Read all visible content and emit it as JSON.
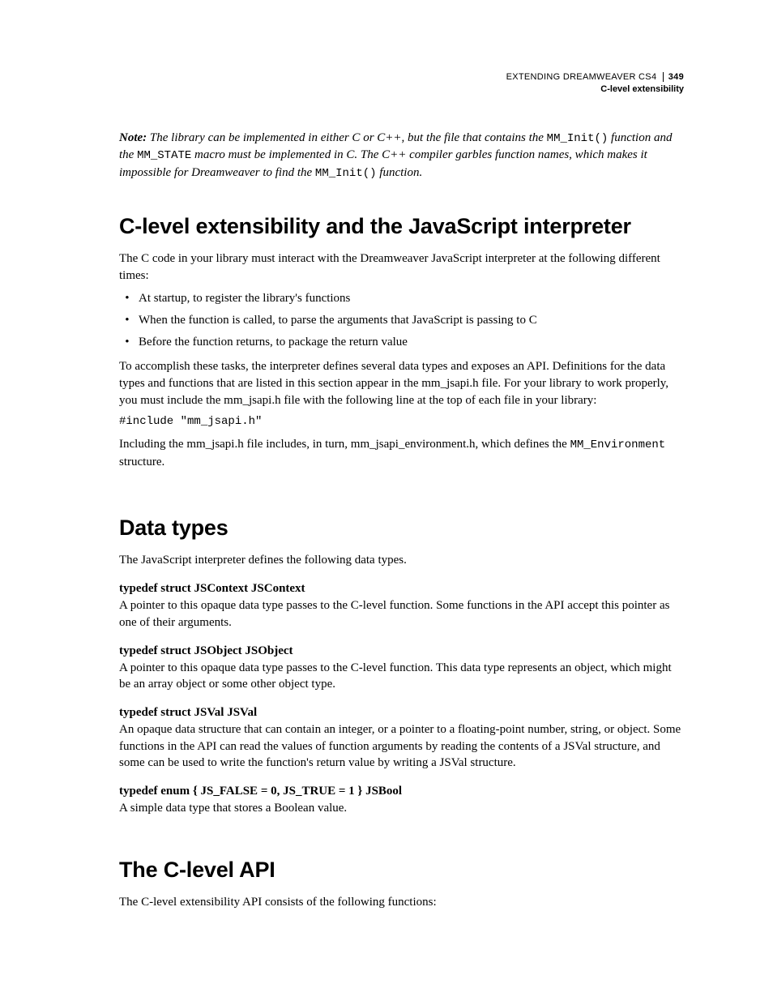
{
  "header": {
    "doc_title": "EXTENDING DREAMWEAVER CS4",
    "page_number": "349",
    "section": "C-level extensibility"
  },
  "note": {
    "label": "Note:",
    "text_a": " The library can be implemented in either C or C++, but the file that contains the ",
    "code_a": "MM_Init()",
    "text_b": " function and the ",
    "code_b": "MM_STATE",
    "text_c": " macro must be implemented in C. The C++ compiler garbles function names, which makes it impossible for Dreamweaver to find the ",
    "code_c": "MM_Init()",
    "text_d": " function."
  },
  "section1": {
    "heading": "C-level extensibility and the JavaScript interpreter",
    "intro": "The C code in your library must interact with the Dreamweaver JavaScript interpreter at the following different times:",
    "bullets": [
      "At startup, to register the library's functions",
      "When the function is called, to parse the arguments that JavaScript is passing to C",
      "Before the function returns, to package the return value"
    ],
    "para2": "To accomplish these tasks, the interpreter defines several data types and exposes an API. Definitions for the data types and functions that are listed in this section appear in the mm_jsapi.h file. For your library to work properly, you must include the mm_jsapi.h file with the following line at the top of each file in your library:",
    "code": "#include \"mm_jsapi.h\"",
    "para3_a": "Including the mm_jsapi.h file includes, in turn, mm_jsapi_environment.h, which defines the ",
    "para3_code": "MM_Environment",
    "para3_b": " structure."
  },
  "section2": {
    "heading": "Data types",
    "intro": "The JavaScript interpreter defines the following data types.",
    "items": [
      {
        "sub": "typedef struct JSContext JSContext",
        "body": "A pointer to this opaque data type passes to the C-level function. Some functions in the API accept this pointer as one of their arguments."
      },
      {
        "sub": "typedef struct JSObject JSObject",
        "body": "A pointer to this opaque data type passes to the C-level function. This data type represents an object, which might be an array object or some other object type."
      },
      {
        "sub": "typedef struct JSVal JSVal",
        "body": "An opaque data structure that can contain an integer, or a pointer to a floating-point number, string, or object. Some functions in the API can read the values of function arguments by reading the contents of a JSVal structure, and some can be used to write the function's return value by writing a JSVal structure."
      },
      {
        "sub": "typedef enum { JS_FALSE = 0, JS_TRUE = 1 } JSBool",
        "body": "A simple data type that stores a Boolean value."
      }
    ]
  },
  "section3": {
    "heading": "The C-level API",
    "intro": "The C-level extensibility API consists of the following functions:"
  }
}
